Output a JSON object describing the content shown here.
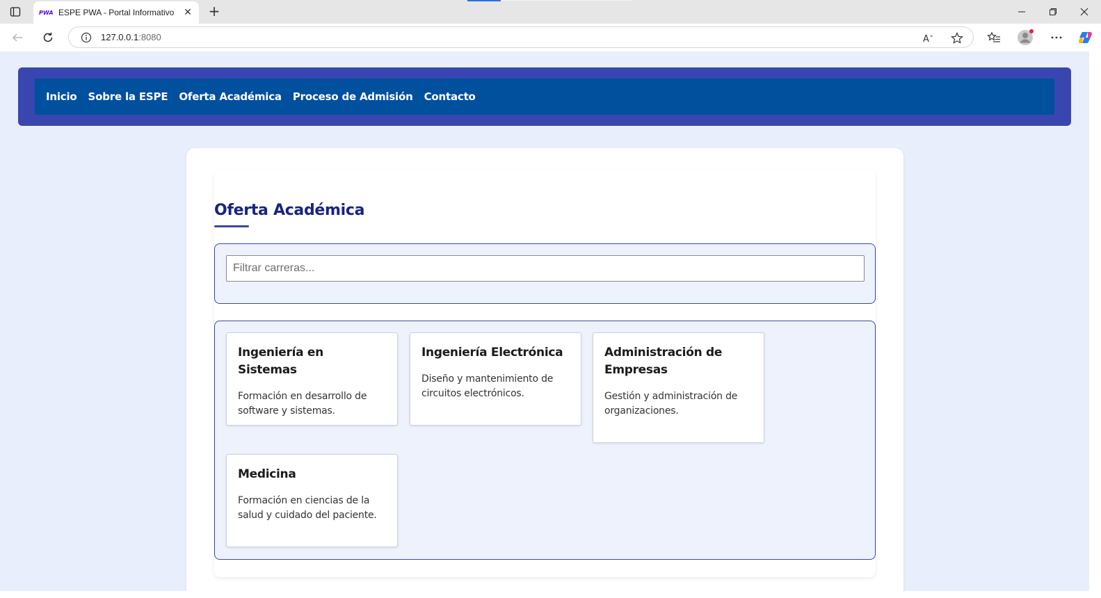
{
  "browser": {
    "tab_title": "ESPE PWA - Portal Informativo",
    "tab_favicon_text": "PWA",
    "address_host": "127.0.0.1",
    "address_port": ":8080",
    "icons": [
      "tab-actions-icon",
      "close-icon",
      "new-tab-icon",
      "minimize-icon",
      "restore-icon",
      "window-close-icon",
      "back-icon",
      "reload-icon",
      "info-icon",
      "read-aloud-icon",
      "favorite-icon",
      "favorites-icon",
      "profile-icon",
      "more-icon",
      "copilot-icon"
    ]
  },
  "site": {
    "nav": [
      "Inicio",
      "Sobre la ESPE",
      "Oferta Académica",
      "Proceso de Admisión",
      "Contacto"
    ]
  },
  "main": {
    "title": "Oferta Académica",
    "filter_placeholder": "Filtrar carreras...",
    "careers": [
      {
        "title": "Ingeniería en Sistemas",
        "description": "Formación en desarrollo de software y sistemas."
      },
      {
        "title": "Ingeniería Electrónica",
        "description": "Diseño y mantenimiento de circuitos electrónicos."
      },
      {
        "title": "Administración de Empresas",
        "description": "Gestión y administración de organizaciones."
      },
      {
        "title": "Medicina",
        "description": "Formación en ciencias de la salud y cuidado del paciente."
      }
    ]
  },
  "colors": {
    "header": "#3a46b0",
    "nav": "#00509e",
    "page_bg": "#e8eefc",
    "title": "#1a237e"
  }
}
